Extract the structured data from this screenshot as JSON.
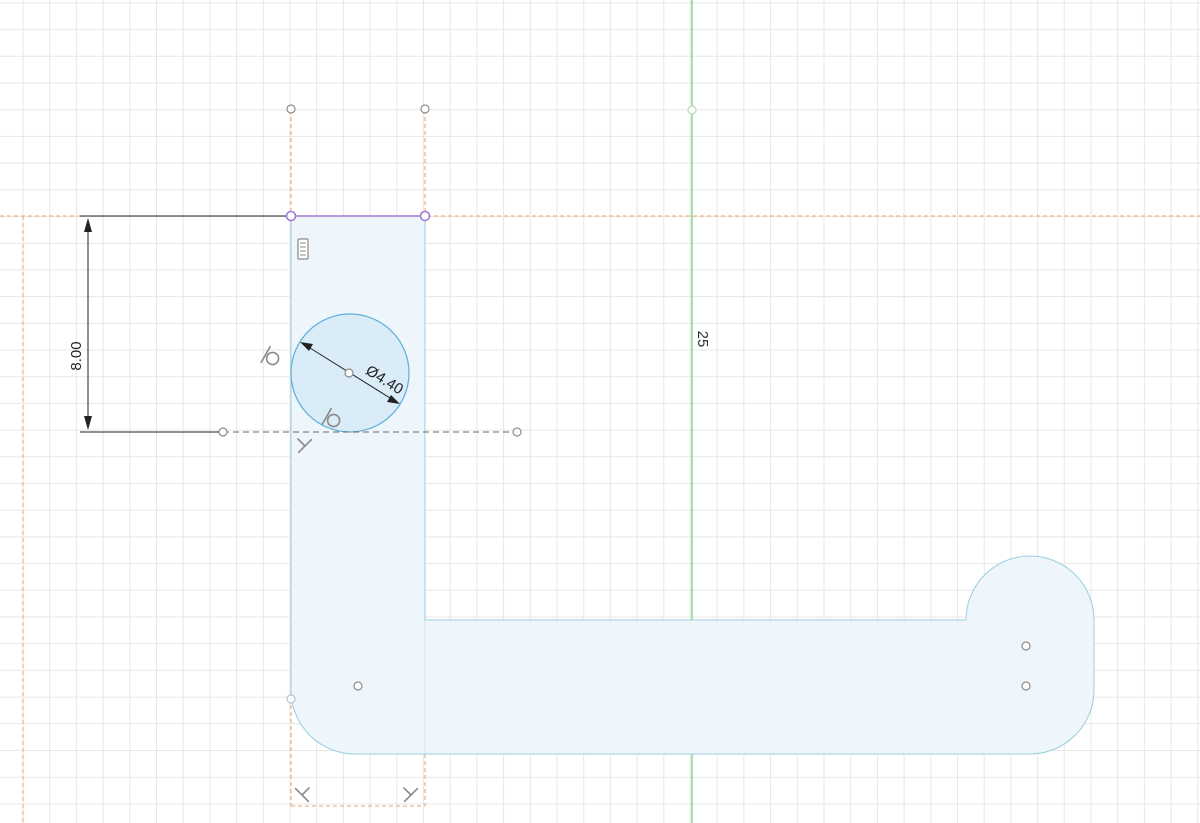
{
  "sketch": {
    "dimensions": {
      "height_label": "8.00",
      "diameter_label": "Ø4.40",
      "axis_label": "25"
    },
    "icons": [
      "concentric-constraint-icon",
      "tangent-constraint-icon",
      "perpendicular-constraint-icon",
      "fix-constraint-icon",
      "horizontal-constraint-icon"
    ],
    "colors": {
      "grid": "#e4e4e4",
      "construction": "#e8a06a",
      "profile_fill": "#eef5fb",
      "profile_stroke": "#98cfe0",
      "circle_fill": "#d5eaf7",
      "circle_stroke": "#5fb0d8",
      "selected": "#a27ad6",
      "vertical_axis": "#4cc94c",
      "dimension": "#222222"
    }
  }
}
